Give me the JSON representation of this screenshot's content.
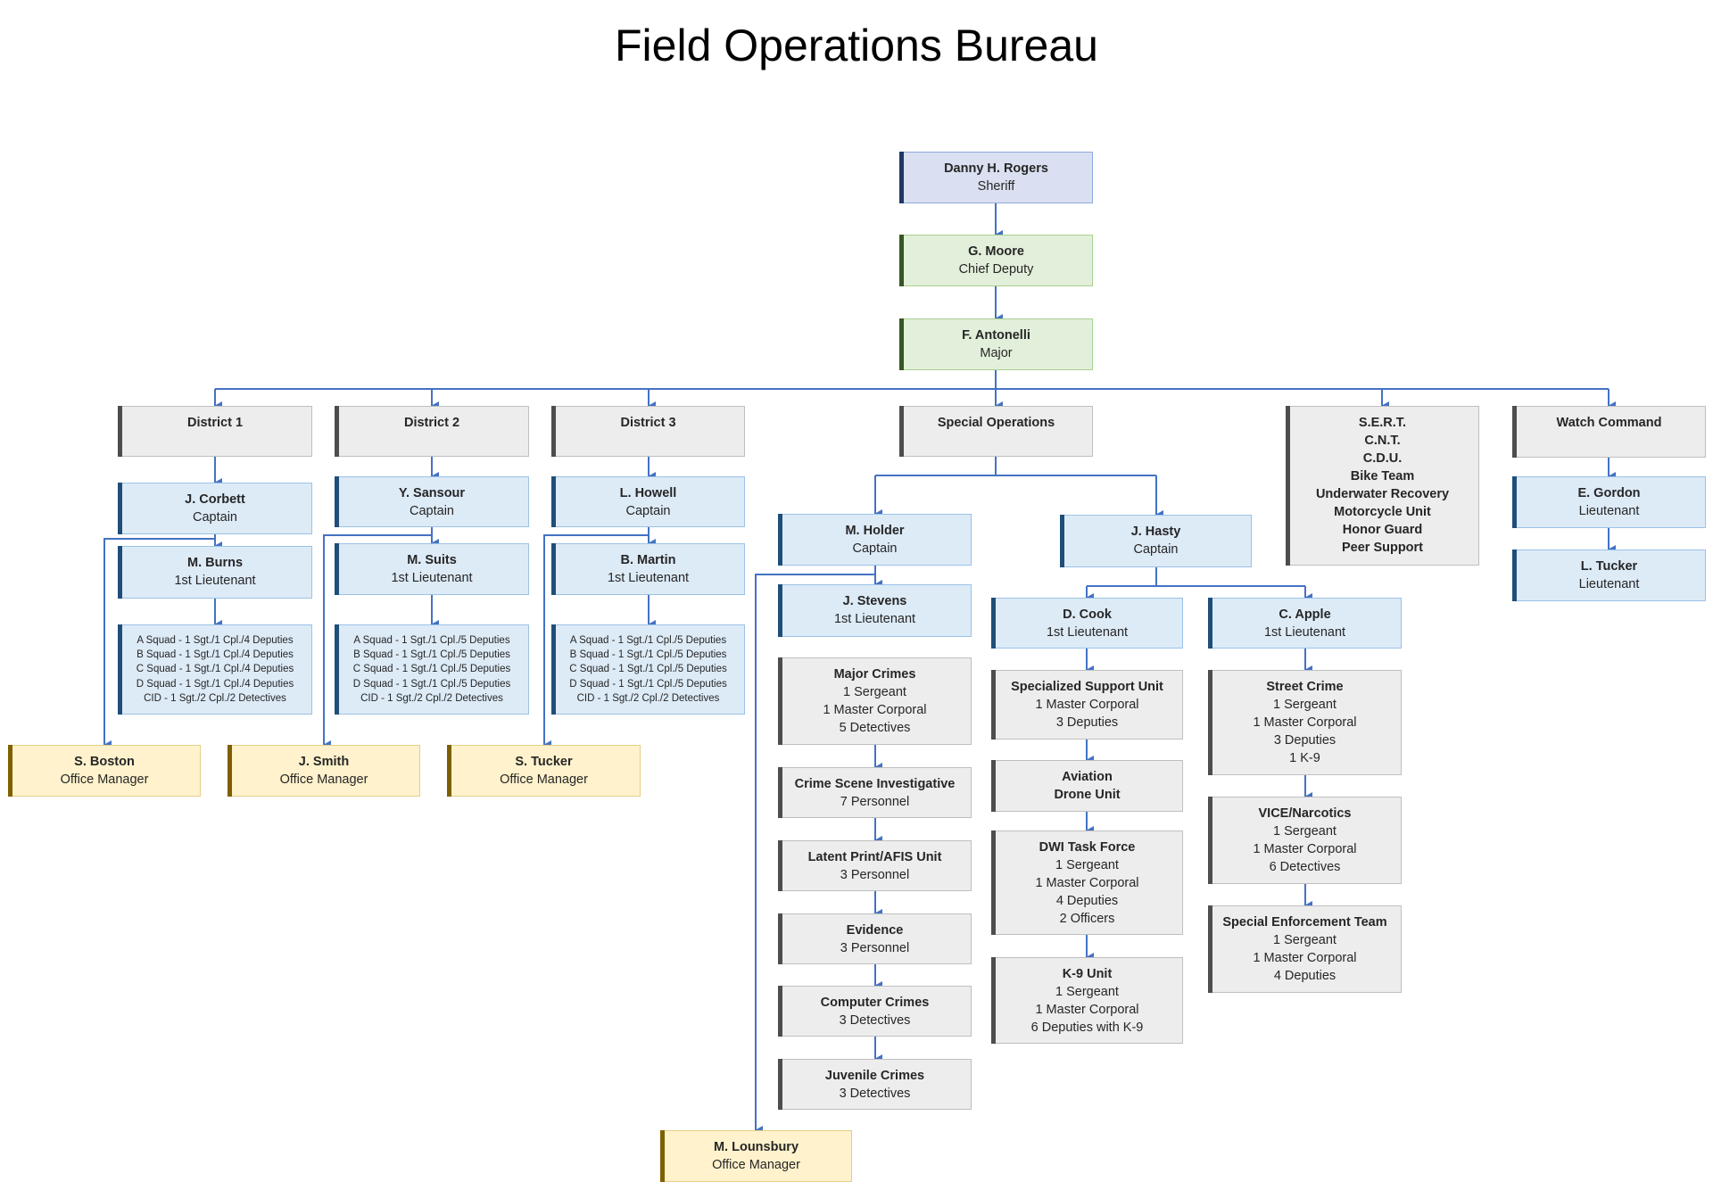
{
  "title": "Field Operations Bureau",
  "colors": {
    "connector": "#4472c4",
    "executive_fill": "#dae0f2",
    "command_fill": "#e2efda",
    "officer_fill": "#ddebf7",
    "unit_fill": "#ededed",
    "office_fill": "#fff2cc"
  },
  "nodes": {
    "sheriff": {
      "name": "Danny H. Rogers",
      "title": "Sheriff"
    },
    "chief_deputy": {
      "name": "G. Moore",
      "title": "Chief Deputy"
    },
    "major": {
      "name": "F. Antonelli",
      "title": "Major"
    },
    "district1": {
      "label": "District 1",
      "captain": {
        "name": "J. Corbett",
        "title": "Captain"
      },
      "lieutenant": {
        "name": "M. Burns",
        "title": "1st Lieutenant"
      },
      "squads": [
        "A Squad - 1 Sgt./1 Cpl./4 Deputies",
        "B Squad - 1 Sgt./1 Cpl./4 Deputies",
        "C Squad - 1 Sgt./1 Cpl./4 Deputies",
        "D Squad - 1 Sgt./1 Cpl./4 Deputies",
        "CID - 1 Sgt./2 Cpl./2 Detectives"
      ],
      "office_manager": {
        "name": "S. Boston",
        "title": "Office Manager"
      }
    },
    "district2": {
      "label": "District 2",
      "captain": {
        "name": "Y. Sansour",
        "title": "Captain"
      },
      "lieutenant": {
        "name": "M. Suits",
        "title": "1st Lieutenant"
      },
      "squads": [
        "A Squad - 1 Sgt./1 Cpl./5 Deputies",
        "B Squad - 1 Sgt./1 Cpl./5 Deputies",
        "C Squad - 1 Sgt./1 Cpl./5 Deputies",
        "D Squad - 1 Sgt./1 Cpl./5 Deputies",
        "CID - 1 Sgt./2 Cpl./2 Detectives"
      ],
      "office_manager": {
        "name": "J. Smith",
        "title": "Office Manager"
      }
    },
    "district3": {
      "label": "District 3",
      "captain": {
        "name": "L. Howell",
        "title": "Captain"
      },
      "lieutenant": {
        "name": "B. Martin",
        "title": "1st Lieutenant"
      },
      "squads": [
        "A Squad - 1 Sgt./1 Cpl./5 Deputies",
        "B Squad - 1 Sgt./1 Cpl./5 Deputies",
        "C Squad - 1 Sgt./1 Cpl./5 Deputies",
        "D Squad - 1 Sgt./1 Cpl./5 Deputies",
        "CID - 1 Sgt./2 Cpl./2 Detectives"
      ],
      "office_manager": {
        "name": "S. Tucker",
        "title": "Office Manager"
      }
    },
    "special_ops": {
      "label": "Special Operations",
      "holder": {
        "name": "M. Holder",
        "title": "Captain"
      },
      "stevens": {
        "name": "J. Stevens",
        "title": "1st Lieutenant"
      },
      "holder_units": [
        {
          "name": "Major Crimes",
          "lines": [
            "1 Sergeant",
            "1 Master Corporal",
            "5 Detectives"
          ]
        },
        {
          "name": "Crime Scene Investigative",
          "lines": [
            "7 Personnel"
          ]
        },
        {
          "name": "Latent Print/AFIS Unit",
          "lines": [
            "3 Personnel"
          ]
        },
        {
          "name": "Evidence",
          "lines": [
            "3 Personnel"
          ]
        },
        {
          "name": "Computer Crimes",
          "lines": [
            "3 Detectives"
          ]
        },
        {
          "name": "Juvenile Crimes",
          "lines": [
            "3 Detectives"
          ]
        }
      ],
      "office_manager": {
        "name": "M. Lounsbury",
        "title": "Office Manager"
      },
      "hasty": {
        "name": "J. Hasty",
        "title": "Captain"
      },
      "cook": {
        "name": "D. Cook",
        "title": "1st Lieutenant"
      },
      "cook_units": [
        {
          "name": "Specialized Support Unit",
          "lines": [
            "1 Master Corporal",
            "3 Deputies"
          ]
        },
        {
          "name": "Aviation",
          "lines": [
            "Drone Unit"
          ]
        },
        {
          "name": "DWI Task Force",
          "lines": [
            "1 Sergeant",
            "1 Master Corporal",
            "4 Deputies",
            "2 Officers"
          ]
        },
        {
          "name": "K-9 Unit",
          "lines": [
            "1 Sergeant",
            "1 Master Corporal",
            "6 Deputies with K-9"
          ]
        }
      ],
      "apple": {
        "name": "C. Apple",
        "title": "1st Lieutenant"
      },
      "apple_units": [
        {
          "name": "Street Crime",
          "lines": [
            "1 Sergeant",
            "1 Master Corporal",
            "3 Deputies",
            "1 K-9"
          ]
        },
        {
          "name": "VICE/Narcotics",
          "lines": [
            "1 Sergeant",
            "1 Master Corporal",
            "6 Detectives"
          ]
        },
        {
          "name": "Special Enforcement Team",
          "lines": [
            "1 Sergeant",
            "1 Master Corporal",
            "4 Deputies"
          ]
        }
      ]
    },
    "teams": {
      "items": [
        "S.E.R.T.",
        "C.N.T.",
        "C.D.U.",
        "Bike Team",
        "Underwater Recovery",
        "Motorcycle Unit",
        "Honor Guard",
        "Peer Support"
      ]
    },
    "watch_command": {
      "label": "Watch Command",
      "gordon": {
        "name": "E. Gordon",
        "title": "Lieutenant"
      },
      "tucker": {
        "name": "L. Tucker",
        "title": "Lieutenant"
      }
    }
  }
}
